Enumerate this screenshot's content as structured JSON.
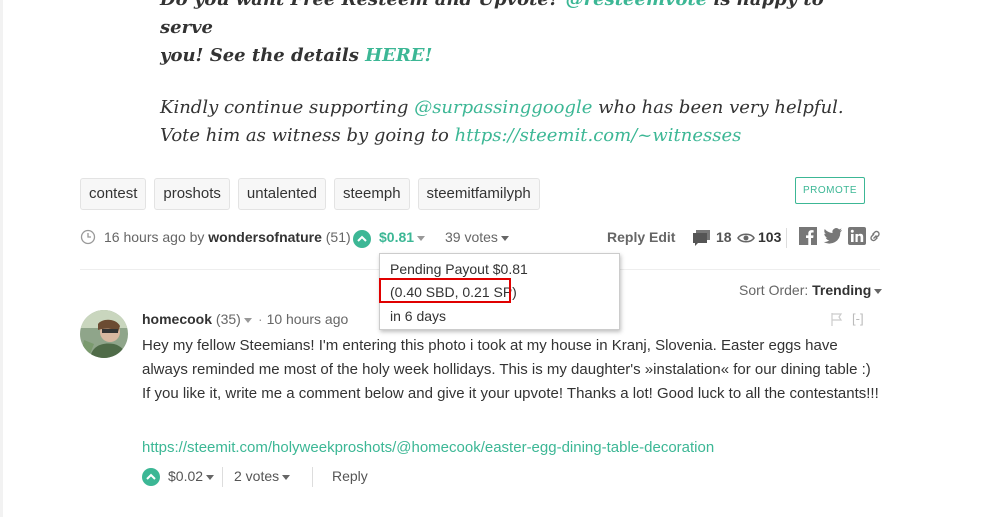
{
  "post": {
    "line1": "Do you want Free Resteem and Upvote?",
    "line1_mention": "@resteemvote",
    "line1_end": "is happy to serve",
    "line2": "you! See the details",
    "line2_link": "HERE!",
    "line3_start": "Kindly continue supporting",
    "line3_mention": "@surpassinggoogle",
    "line3_end": "who has been very helpful.",
    "line4_start": "Vote him as witness by going to",
    "line4_link": "https://steemit.com/~witnesses"
  },
  "tags": [
    "contest",
    "proshots",
    "untalented",
    "steemph",
    "steemitfamilyph"
  ],
  "promote_label": "PROMOTE",
  "meta": {
    "time": "16 hours ago by",
    "author": "wondersofnature",
    "reputation": "(51)",
    "payout": "$0.81",
    "votes": "39 votes",
    "reply": "Reply",
    "edit": "Edit",
    "comments_count": "18",
    "views_count": "103"
  },
  "tooltip": {
    "pending": "Pending Payout $0.81",
    "breakdown": "(0.40 SBD, 0.21 SP)",
    "time_left": "in 6 days"
  },
  "sort": {
    "label": "Sort Order:",
    "value": "Trending"
  },
  "comment": {
    "author": "homecook",
    "reputation": "(35)",
    "time": "10 hours ago",
    "collapse": "[-]",
    "body": "Hey my fellow Steemians! I'm entering this photo i took at my house in Kranj, Slovenia. Easter eggs have always reminded me most of the holy week hollidays. This is my daughter's »instalation« for our dining table :) If you like it, write me a comment below and give it your upvote! Thanks a lot! Good luck to all the contestants!!!",
    "link": "https://steemit.com/holyweekproshots/@homecook/easter-egg-dining-table-decoration",
    "payout": "$0.02",
    "votes": "2 votes",
    "reply": "Reply"
  },
  "colors": {
    "accent": "#3cb795",
    "highlight": "#e00000"
  }
}
